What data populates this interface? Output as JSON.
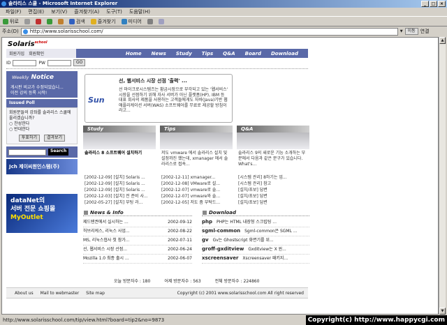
{
  "window": {
    "title": "솔라리스 스쿨 - Microsoft Internet Explorer"
  },
  "menu": [
    "파일(F)",
    "편집(E)",
    "보기(V)",
    "즐겨찾기(A)",
    "도구(T)",
    "도움말(H)"
  ],
  "toolbar": {
    "back": "뒤로",
    "search": "검색",
    "favorites": "즐겨찾기",
    "media": "미디어"
  },
  "address": {
    "label": "주소(D)",
    "url": "http://www.solarisschool.com/",
    "go": "이동",
    "links": "연결"
  },
  "site": {
    "logo": "Solaris",
    "logo_small": "school",
    "nav": [
      "Home",
      "News",
      "Study",
      "Tips",
      "Q&A",
      "Board",
      "Download"
    ],
    "login": {
      "join": "회원가입",
      "check": "회원확인",
      "id_label": "ID",
      "pw_label": "PW",
      "go": "GO"
    },
    "notice": {
      "weekly": "Weekly",
      "title": "Notice",
      "items": [
        "게시판 비교가 수정되었습니...",
        "이전 강의 등록 시작!"
      ]
    },
    "poll": {
      "title": "Issued Poll",
      "question": "회원분들의 강좌를 솔라리스 스쿨에 올리겠습니까?",
      "opt1": "찬성한다",
      "opt2": "반대한다",
      "vote": "투표하기",
      "result": "결과보기"
    },
    "search": {
      "button": "Search"
    },
    "banner1": "Jch 제이씨원인스템(주)",
    "banner2": {
      "line1": "dataNet의",
      "line2": "서버 전문 쇼핑몰",
      "line3": "MyOutlet"
    },
    "feature": {
      "title": "선, 웹서비스 시장 선점 '출력' ...",
      "logo": "Sun",
      "body": "선 마이크로시스템즈는 황금시장으로 부각되고 있는 '웹서비스' 시장을 선점하기 위해 자사 서버가 아닌 플랫폼(HP), IBM 등 대표 회사의 제품을 사용하는 고객들에게도 자바(Java)기반 웹애플리케이션 서버(WAS) 소프트웨어를 무료로 제공할 방침이라고..."
    },
    "columns": [
      {
        "title": "Study",
        "text": "",
        "headline": "솔라리스 8 소프트웨어 설치하기",
        "rows": [
          "[2002-12-09] [설치] Solaris ...",
          "[2002-12-09] [설치] Solaris ...",
          "[2002-12-09] [설치] Solaris ...",
          "[2002-12-03] [설치] 전 준비 사...",
          "[2002-05-27] [설치] 부팅 과..."
        ]
      },
      {
        "title": "Tips",
        "text": "저도 vmware 에서 솔라리스 설치 및 설정까진 했는데, xmanager 에서 솔라리스로 접속...",
        "headline": "",
        "rows": [
          "[2002-12-11] xmanager...",
          "[2002-12-08] VMware로 설...",
          "[2002-12-07] vmware로 솔...",
          "[2002-12-07] vmware와 솔...",
          "[2002-12-05] 저도 좀 부탁드..."
        ]
      },
      {
        "title": "Q&A",
        "text": "솔라리스 9의 새로운 기능 소개하는 부분에서 다음과 같은 문구가 있습니다. What's...",
        "headline": "",
        "rows": [
          "[시스템 관리] 8하기는 업...",
          "[시스템 관리] 참고",
          "[설치/초보] 답변",
          "[설치/초보] 답변",
          "[설치/초보] 답변"
        ]
      }
    ],
    "news": {
      "title": "News & Info",
      "items": [
        {
          "t": "제드텐권에서 실시하는 ...",
          "d": "2002-09-12"
        },
        {
          "t": "허브리케스, 리눅스 사업...",
          "d": "2002-08-22"
        },
        {
          "t": "MS, 리눅스협사 첫 참가...",
          "d": "2002-07-11"
        },
        {
          "t": "선, 웹서비스 시장 선점...",
          "d": "2002-06-24"
        },
        {
          "t": "Mozilla 1.0 최종 출시 ...",
          "d": "2002-06-07"
        }
      ]
    },
    "download": {
      "title": "Download",
      "items": [
        {
          "n": "php",
          "d": "PHP는 HTML 내장형 스크립팅 ..."
        },
        {
          "n": "sgml-common",
          "d": "Sgml-common은 SGML ..."
        },
        {
          "n": "gv",
          "d": "Gv는 Ghostscript 화면기를 위..."
        },
        {
          "n": "groff-gxditview",
          "d": "Gxditview는 X 윈..."
        },
        {
          "n": "xscreensaver",
          "d": "Xscreensaver 패키지..."
        }
      ]
    },
    "visits": {
      "today": "오늘 방문자수 : 180",
      "yesterday": "어제 방문자수 : 563",
      "total": "전체 방문자수 : 224860"
    },
    "footer": {
      "about": "About us",
      "mail": "Mail to webmaster",
      "sitemap": "Site map",
      "copyright": "Copyright (c) 2001 www.solarisschool.com All right reserved"
    }
  },
  "status": {
    "url": "http://www.solarisschool.com/tip/view.html?board=tip2&no=9873"
  },
  "overlay": {
    "copyright": "Copyright(c) http://www.happycgi.com"
  }
}
